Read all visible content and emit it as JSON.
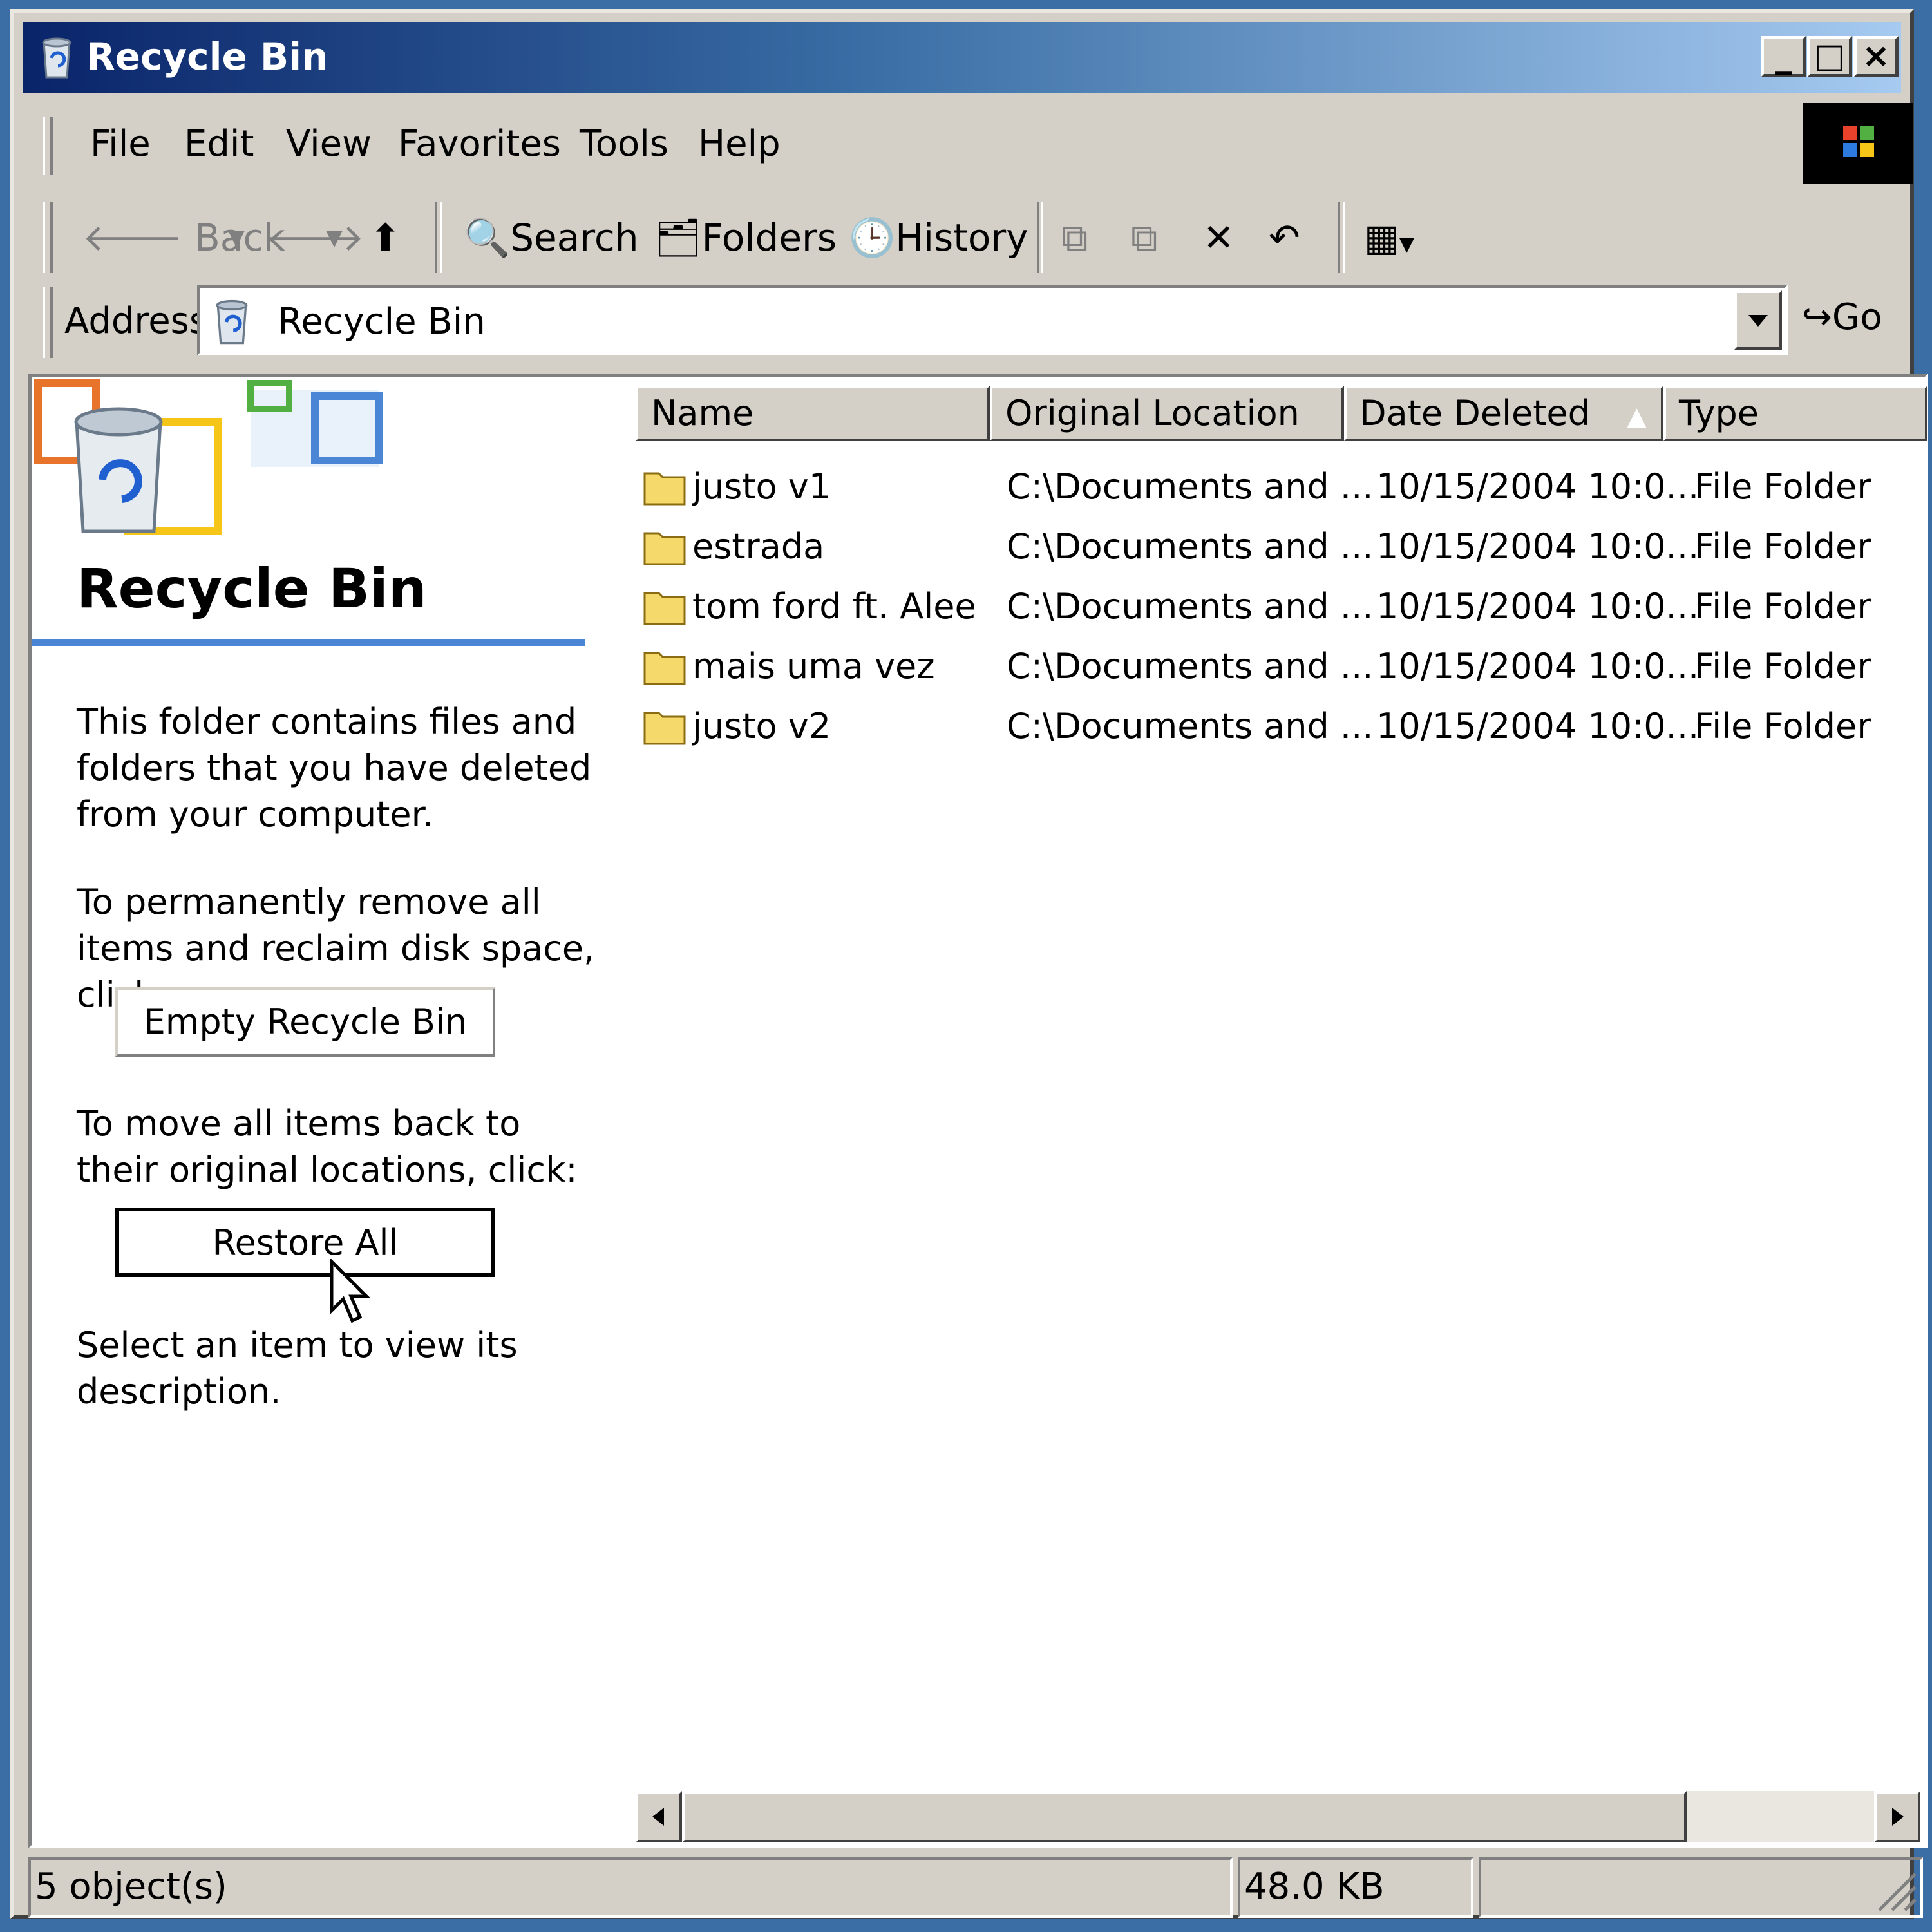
{
  "window": {
    "title": "Recycle Bin"
  },
  "menu": {
    "items": [
      "File",
      "Edit",
      "View",
      "Favorites",
      "Tools",
      "Help"
    ]
  },
  "toolbar": {
    "back": "Back",
    "search": "Search",
    "folders": "Folders",
    "history": "History"
  },
  "address": {
    "label": "Address",
    "value": "Recycle Bin",
    "go": "Go"
  },
  "panel": {
    "title": "Recycle Bin",
    "description": "This folder contains files and folders that you have deleted from your computer.",
    "empty_prompt": "To permanently remove all items and reclaim disk space, click:",
    "empty_button": "Empty Recycle Bin",
    "restore_prompt": "To move all items back to their original locations, click:",
    "restore_button": "Restore All",
    "select_hint": "Select an item to view its description."
  },
  "list": {
    "columns": [
      "Name",
      "Original Location",
      "Date Deleted",
      "Type"
    ],
    "rows": [
      {
        "name": "justo v1",
        "location": "C:\\Documents and ...",
        "date": "10/15/2004 10:0...",
        "type": "File Folder"
      },
      {
        "name": "estrada",
        "location": "C:\\Documents and ...",
        "date": "10/15/2004 10:0...",
        "type": "File Folder"
      },
      {
        "name": "tom ford ft. Alee",
        "location": "C:\\Documents and ...",
        "date": "10/15/2004 10:0...",
        "type": "File Folder"
      },
      {
        "name": "mais uma vez",
        "location": "C:\\Documents and ...",
        "date": "10/15/2004 10:0...",
        "type": "File Folder"
      },
      {
        "name": "justo v2",
        "location": "C:\\Documents and ...",
        "date": "10/15/2004 10:0...",
        "type": "File Folder"
      }
    ]
  },
  "status": {
    "objects": "5 object(s)",
    "size": "48.0 KB"
  },
  "icons": {
    "app": "recycle-bin-icon",
    "folder": "folder-icon",
    "sort": "sort-ascending-icon"
  },
  "colors": {
    "title_start": "#0a246a",
    "title_end": "#a6caf0",
    "desktop": "#3a6ea5",
    "accent_rule": "#4b86d6",
    "folder": "#f5d96b"
  }
}
